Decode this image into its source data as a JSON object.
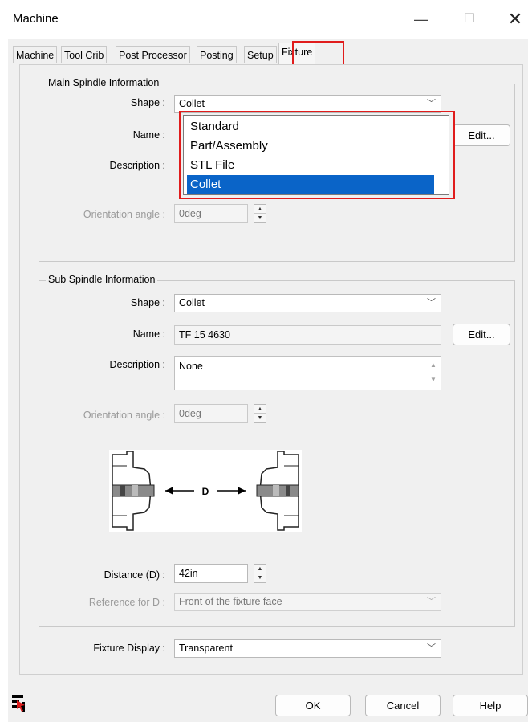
{
  "window": {
    "title": "Machine",
    "min_glyph": "—",
    "max_glyph": "☐",
    "close_glyph": "✕"
  },
  "tabs": [
    "Machine",
    "Tool Crib",
    "Post Processor",
    "Posting",
    "Setup",
    "Fixture"
  ],
  "active_tab": "Fixture",
  "main_spindle": {
    "group_title": "Main Spindle Information",
    "shape_label": "Shape :",
    "shape_value": "Collet",
    "name_label": "Name :",
    "description_label": "Description :",
    "orientation_label": "Orientation angle :",
    "orientation_value": "0deg",
    "edit_label": "Edit...",
    "dropdown_options": [
      "Standard",
      "Part/Assembly",
      "STL File",
      "Collet"
    ],
    "dropdown_selected": "Collet"
  },
  "sub_spindle": {
    "group_title": "Sub Spindle Information",
    "shape_label": "Shape :",
    "shape_value": "Collet",
    "name_label": "Name :",
    "name_value": "TF 15 4630",
    "edit_label": "Edit...",
    "description_label": "Description :",
    "description_value": "None",
    "orientation_label": "Orientation angle :",
    "orientation_value": "0deg",
    "diagram_label": "D",
    "distance_label": "Distance (D) :",
    "distance_value": "42in",
    "reference_label": "Reference for D :",
    "reference_value": "Front of the fixture face"
  },
  "fixture_display": {
    "label": "Fixture Display :",
    "value": "Transparent"
  },
  "footer": {
    "ok": "OK",
    "cancel": "Cancel",
    "help": "Help"
  },
  "colors": {
    "highlight": "#e01c1c",
    "selection": "#0a64c8"
  }
}
